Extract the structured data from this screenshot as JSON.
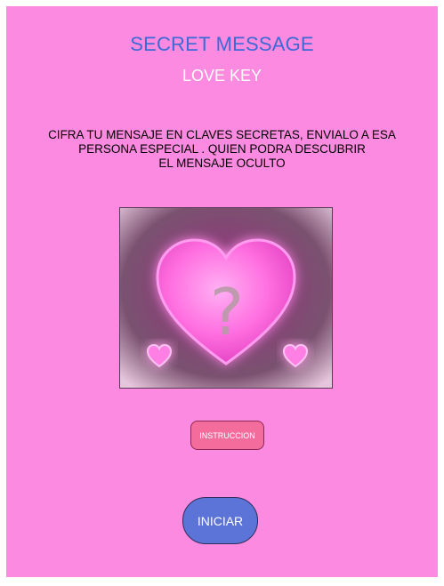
{
  "header": {
    "title": "SECRET MESSAGE",
    "subtitle": "LOVE KEY"
  },
  "description": "CIFRA TU MENSAJE  EN CLAVES SECRETAS, ENVIALO A ESA\nPERSONA  ESPECIAL . QUIEN  PODRA DESCUBRIR\nEL MENSAJE OCULTO",
  "image": {
    "icon": "heart-question-icon",
    "question_mark": "?"
  },
  "buttons": {
    "instructions_label": "INSTRUCCION",
    "start_label": "INICIAR"
  },
  "colors": {
    "background": "#fb8ae0",
    "title": "#3b6ad6",
    "instructions_button": "#f46c9c",
    "start_button": "#5c74d8"
  }
}
